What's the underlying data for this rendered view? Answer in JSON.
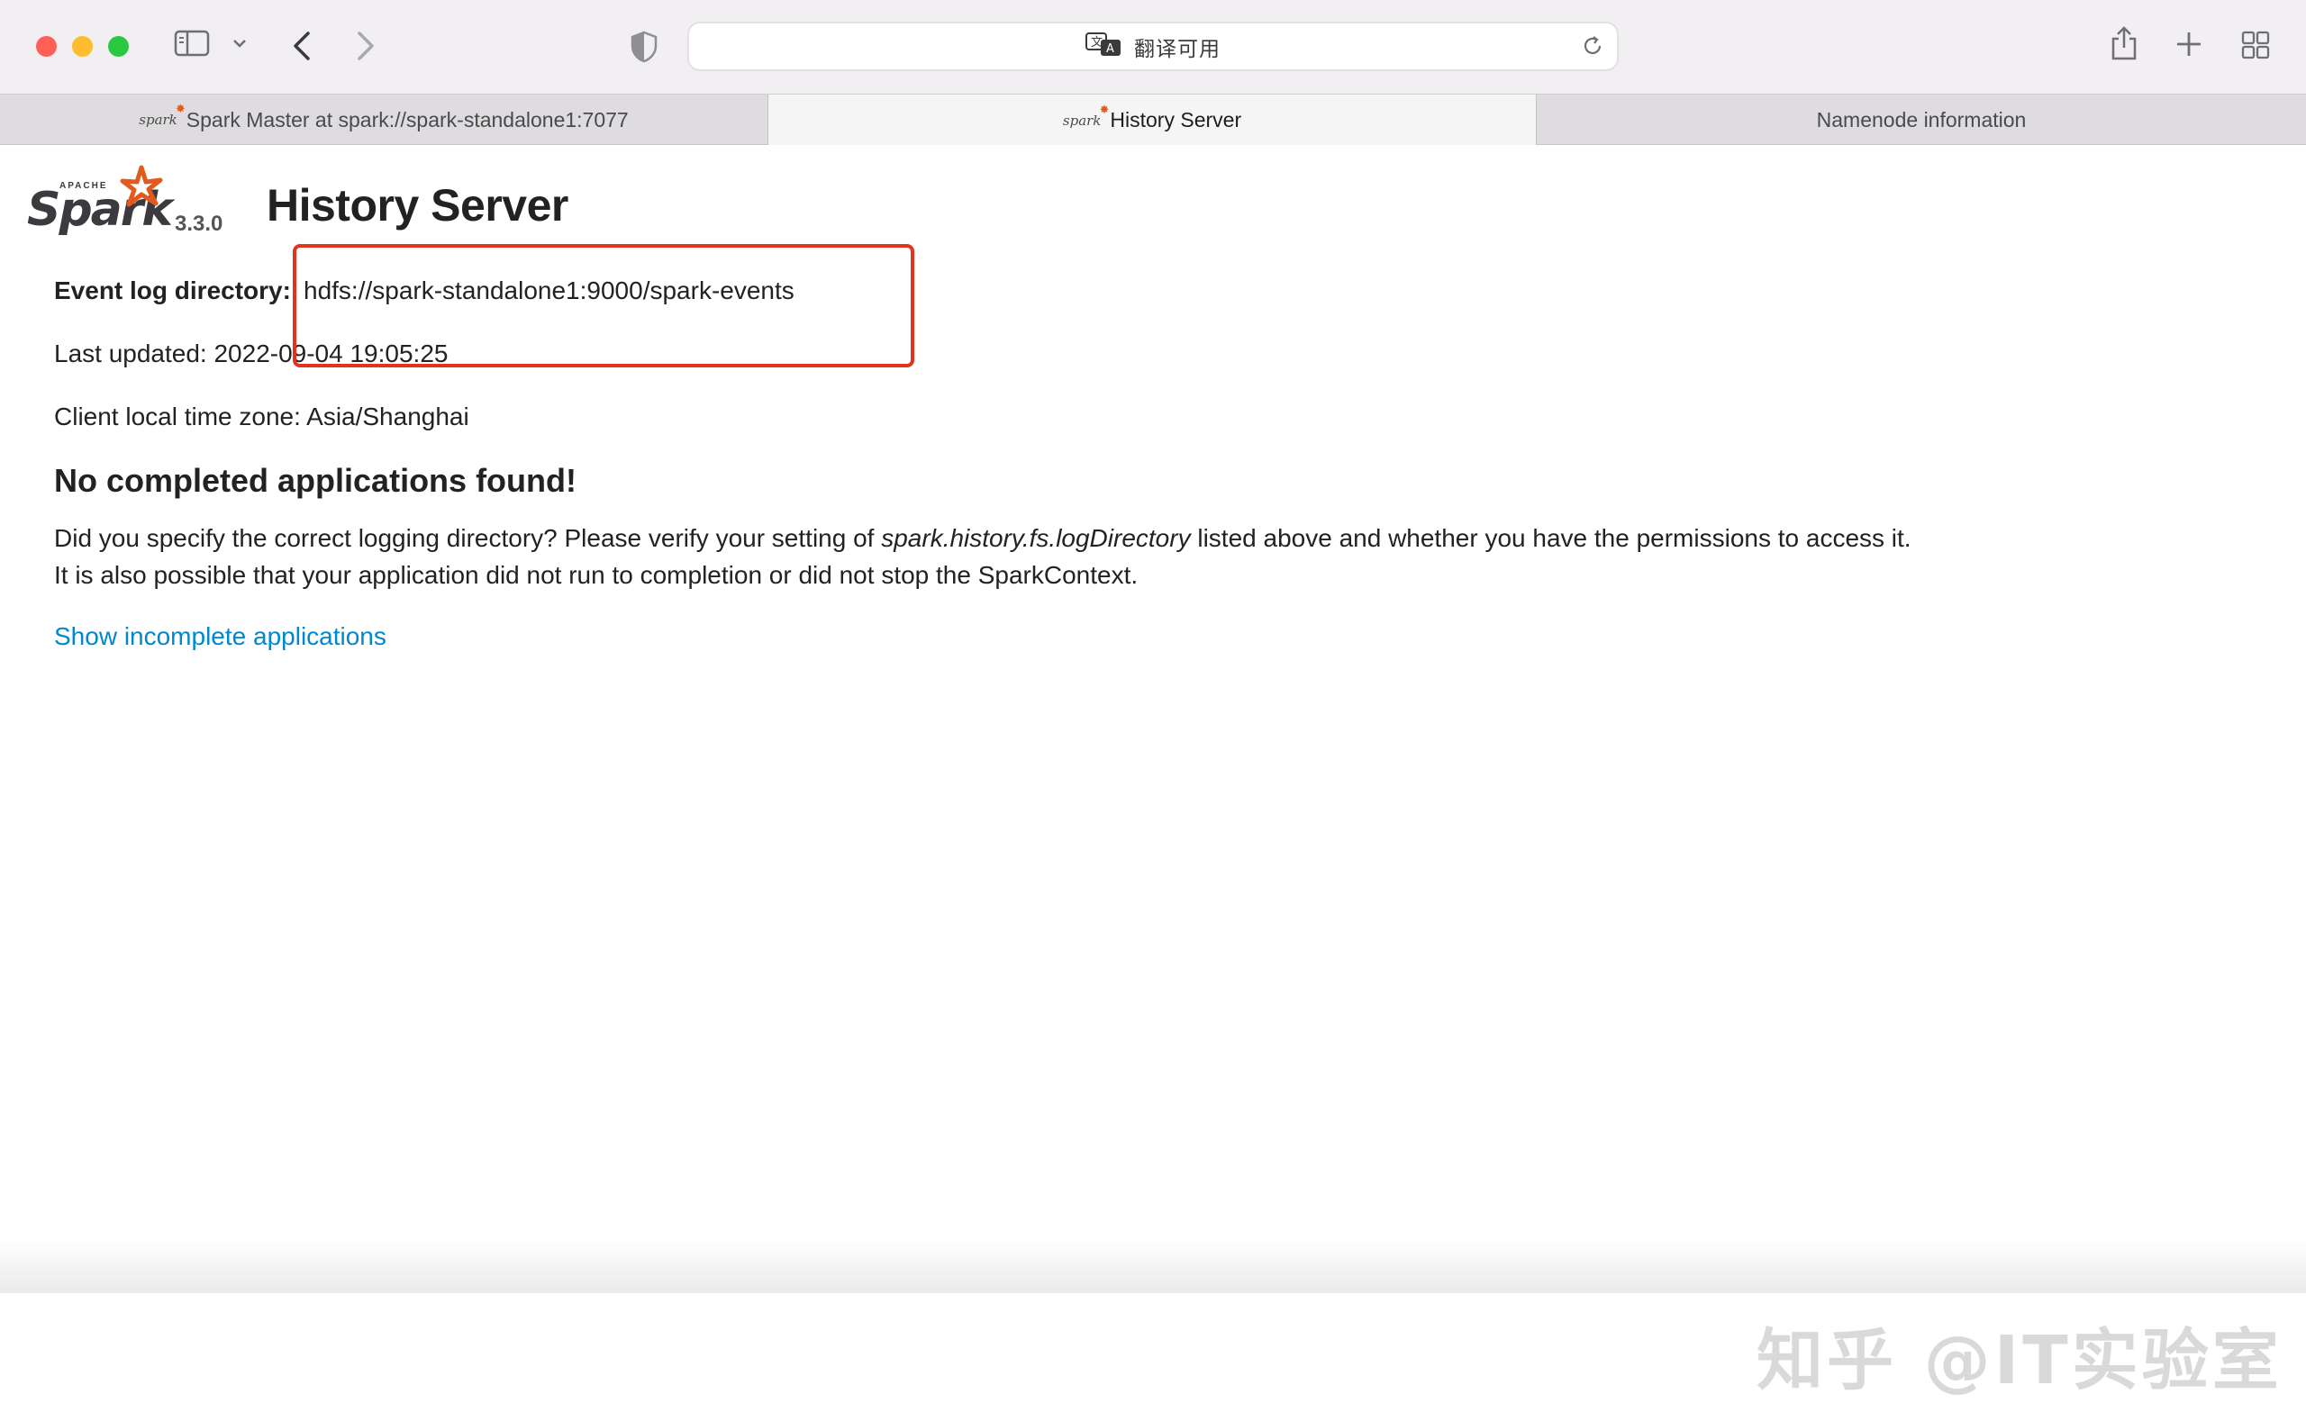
{
  "browser": {
    "address_text": "翻译可用",
    "tabs": [
      {
        "label": "Spark Master at spark://spark-standalone1:7077",
        "favicon": "spark",
        "active": false
      },
      {
        "label": "History Server",
        "favicon": "spark",
        "active": true
      },
      {
        "label": "Namenode information",
        "favicon": "",
        "active": false
      }
    ]
  },
  "page": {
    "logo_apache": "APACHE",
    "logo_spark": "Spark",
    "version": "3.3.0",
    "title": "History Server",
    "event_log_label": "Event log directory:",
    "event_log_value": "hdfs://spark-standalone1:9000/spark-events",
    "last_updated": "Last updated: 2022-09-04 19:05:25",
    "timezone": "Client local time zone: Asia/Shanghai",
    "no_apps_heading": "No completed applications found!",
    "message_part1": "Did you specify the correct logging directory? Please verify your setting of ",
    "message_code": "spark.history.fs.logDirectory",
    "message_part2": " listed above and whether you have the permissions to access it.",
    "message_line2": "It is also possible that your application did not run to completion or did not stop the SparkContext.",
    "show_incomplete_link": "Show incomplete applications"
  },
  "annotation": {
    "color": "#e03320"
  },
  "watermark": "知乎 @IT实验室",
  "colors": {
    "link": "#0088cc",
    "accent_orange": "#e25a1c",
    "toolbar_bg": "#f1eff1"
  }
}
